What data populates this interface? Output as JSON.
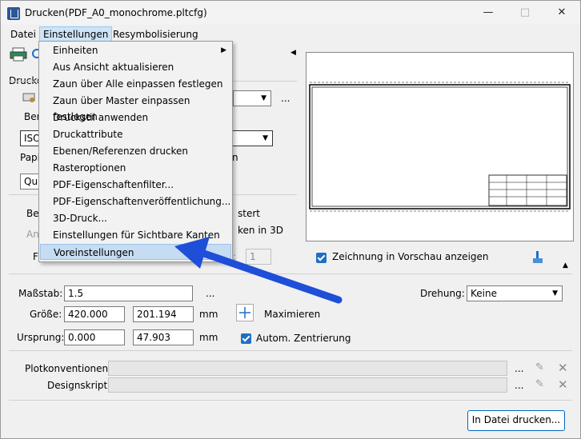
{
  "window": {
    "title": "Drucken(PDF_A0_monochrome.pltcfg)"
  },
  "menubar": {
    "items": [
      "Datei",
      "Einstellungen",
      "Resymbolisierung"
    ]
  },
  "dropdown": {
    "items": [
      "Einheiten",
      "Aus Ansicht aktualisieren",
      "Zaun über Alle einpassen festlegen",
      "Zaun über Master einpassen festlegen",
      "Druckstil anwenden",
      "Druckattribute",
      "Ebenen/Referenzen drucken",
      "Rasteroptionen",
      "PDF-Eigenschaftenfilter...",
      "PDF-Eigenschaftenveröffentlichung...",
      "3D-Druck...",
      "Einstellungen für Sichtbare Kanten",
      "Voreinstellungen"
    ],
    "highlighted": "Voreinstellungen"
  },
  "left_panel": {
    "druck_label": "Drucke",
    "ben_label": "Ben",
    "iso_value": "ISO",
    "papi_label": "Papie",
    "qu_value": "Qu",
    "ber_label": "Ber",
    "ans_label": "Ans",
    "f_label": "F",
    "stert_text": "stert",
    "ken3d_text": "ken in 3D",
    "copies_value": "1",
    "ellipsis": "..."
  },
  "preview": {
    "show_label": "Zeichnung in Vorschau anzeigen"
  },
  "scale": {
    "massstab_label": "Maßstab:",
    "massstab_value": "1.5",
    "groesse_label": "Größe:",
    "width_value": "420.000",
    "height_value": "201.194",
    "unit": "mm",
    "maximieren_label": "Maximieren",
    "ursprung_label": "Ursprung:",
    "origin_x": "0.000",
    "origin_y": "47.903",
    "unit2": "mm",
    "zentrierung_label": "Autom. Zentrierung",
    "drehung_label": "Drehung:",
    "drehung_value": "Keine"
  },
  "bottom": {
    "plotkonventionen_label": "Plotkonventionen:",
    "designskript_label": "Designskript:",
    "print_button": "In Datei drucken..."
  }
}
